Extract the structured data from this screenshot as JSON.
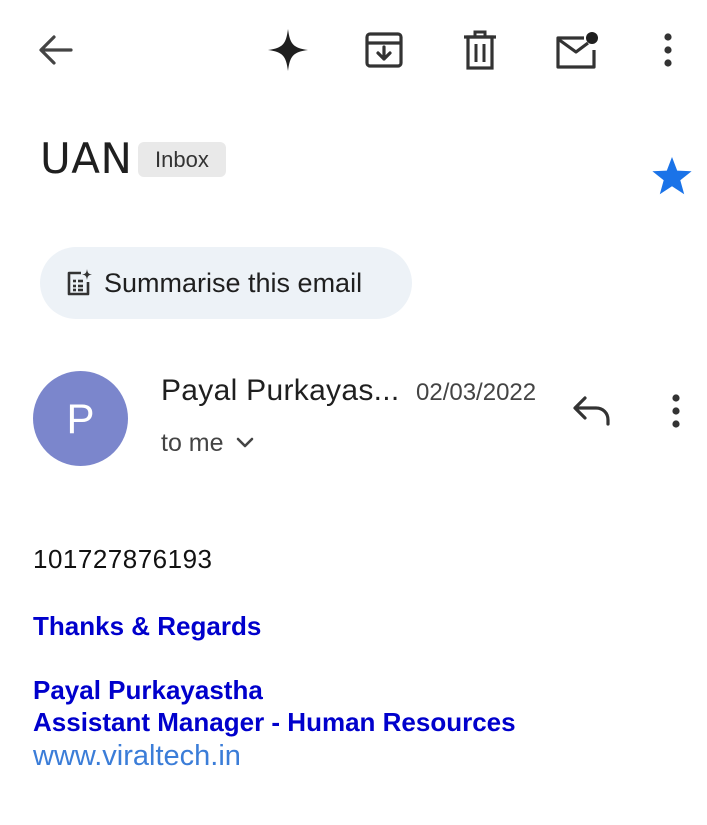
{
  "toolbar": {
    "back_icon": "back-arrow-icon",
    "gemini_icon": "sparkle-icon",
    "archive_icon": "archive-icon",
    "delete_icon": "trash-icon",
    "mark_unread_icon": "mail-unread-icon",
    "more_icon": "more-vert-icon"
  },
  "email": {
    "subject": "UAN",
    "label": "Inbox",
    "starred": true,
    "star_color": "#1a73e8",
    "summarise_label": "Summarise this email",
    "sender": {
      "initial": "P",
      "name": "Payal Purkayas...",
      "date": "02/03/2022",
      "recipient_line": "to me",
      "avatar_color": "#7b86cc"
    },
    "body": {
      "number": "101727876193",
      "signoff": "Thanks & Regards",
      "signature_name": "Payal Purkayastha",
      "signature_title": "Assistant Manager - Human Resources",
      "website": "www.viraltech.in"
    }
  },
  "colors": {
    "signature": "#0000cc",
    "link": "#3b7dd8",
    "chip_bg": "#e9e9e9",
    "summarise_bg": "#edf2f7"
  }
}
